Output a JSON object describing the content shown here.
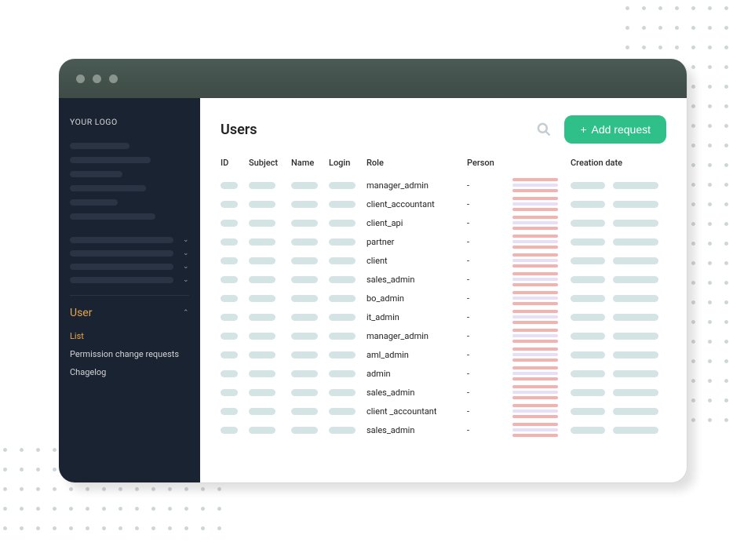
{
  "sidebar": {
    "logo": "YOUR LOGO",
    "expanded_section": {
      "title": "User",
      "items": [
        "List",
        "Permission change requests",
        "Chagelog"
      ],
      "active_index": 0
    }
  },
  "header": {
    "title": "Users",
    "add_button": "Add request"
  },
  "table": {
    "columns": [
      "ID",
      "Subject",
      "Name",
      "Login",
      "Role",
      "Person",
      "",
      "Creation date"
    ],
    "rows": [
      {
        "role": "manager_admin",
        "person": "-"
      },
      {
        "role": "client_accountant",
        "person": "-"
      },
      {
        "role": "client_api",
        "person": "-"
      },
      {
        "role": "partner",
        "person": "-"
      },
      {
        "role": "client",
        "person": "-"
      },
      {
        "role": "sales_admin",
        "person": "-"
      },
      {
        "role": "bo_admin",
        "person": "-"
      },
      {
        "role": "it_admin",
        "person": "-"
      },
      {
        "role": "manager_admin",
        "person": "-"
      },
      {
        "role": "aml_admin",
        "person": "-"
      },
      {
        "role": "admin",
        "person": "-"
      },
      {
        "role": "sales_admin",
        "person": "-"
      },
      {
        "role": "client _accountant",
        "person": "-"
      },
      {
        "role": "sales_admin",
        "person": "-"
      }
    ]
  },
  "colors": {
    "accent_green": "#2fc08a",
    "accent_gold": "#e8a74d",
    "sidebar_bg": "#1a2332",
    "skeleton_teal": "#d4e3e4",
    "status_red": "#f4b2af",
    "status_lav": "#e8def5"
  }
}
